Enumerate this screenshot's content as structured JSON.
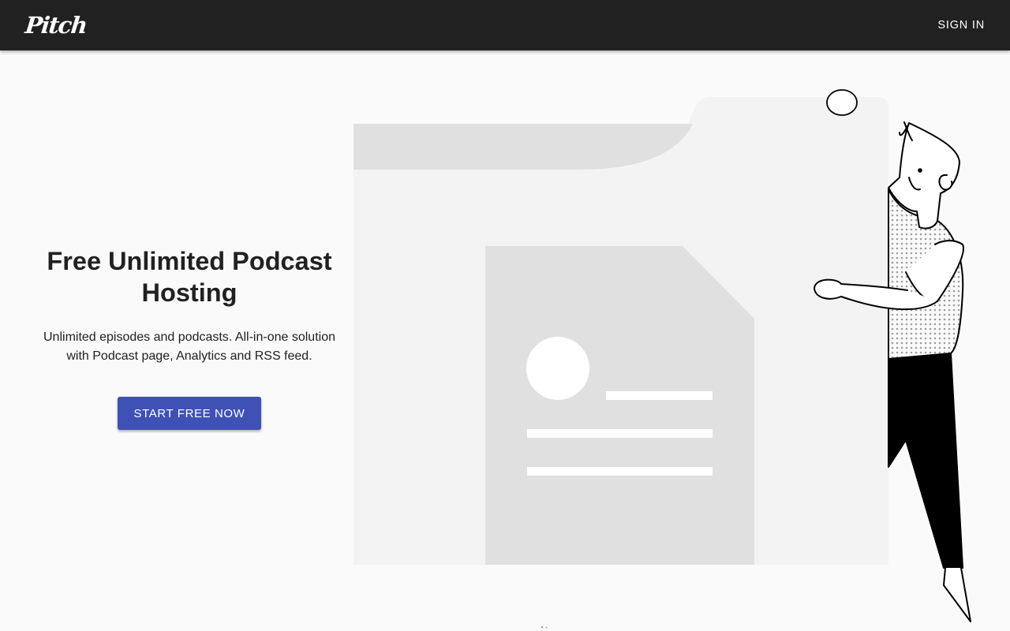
{
  "header": {
    "logo": "Pitch",
    "signin_label": "SIGN IN"
  },
  "hero": {
    "title": "Free Unlimited Podcast Hosting",
    "subtitle": "Unlimited episodes and podcasts. All-in-one solution with Podcast page, Analytics and RSS feed.",
    "cta_label": "START FREE NOW"
  },
  "colors": {
    "header_bg": "#212121",
    "page_bg": "#fafafa",
    "primary": "#3f51b5"
  }
}
